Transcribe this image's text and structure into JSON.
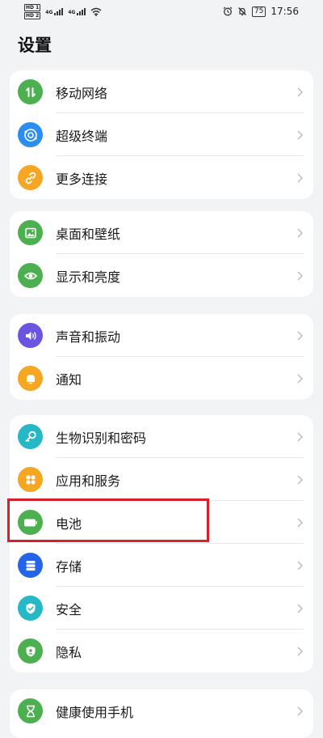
{
  "status_bar": {
    "hd1": "HD 1",
    "hd2": "HD 2",
    "net1": "4G",
    "net2": "4G",
    "battery": "75",
    "time": "17:56"
  },
  "page_title": "设置",
  "colors": {
    "green": "#4caf50",
    "blue": "#2a8ef0",
    "orange": "#f5a623",
    "purple": "#6a55e0",
    "teal": "#27b8c8",
    "navy": "#2464e8",
    "highlight": "#d8202a"
  },
  "groups": [
    {
      "items": [
        {
          "label": "移动网络",
          "icon": "mobile-data-icon"
        },
        {
          "label": "超级终端",
          "icon": "super-device-icon"
        },
        {
          "label": "更多连接",
          "icon": "link-icon"
        }
      ]
    },
    {
      "items": [
        {
          "label": "桌面和壁纸",
          "icon": "wallpaper-icon"
        },
        {
          "label": "显示和亮度",
          "icon": "eye-icon"
        }
      ]
    },
    {
      "items": [
        {
          "label": "声音和振动",
          "icon": "speaker-icon"
        },
        {
          "label": "通知",
          "icon": "bell-icon"
        }
      ]
    },
    {
      "items": [
        {
          "label": "生物识别和密码",
          "icon": "key-icon"
        },
        {
          "label": "应用和服务",
          "icon": "apps-icon"
        },
        {
          "label": "电池",
          "icon": "battery-icon"
        },
        {
          "label": "存储",
          "icon": "storage-icon"
        },
        {
          "label": "安全",
          "icon": "shield-icon"
        },
        {
          "label": "隐私",
          "icon": "privacy-icon"
        }
      ]
    },
    {
      "items": [
        {
          "label": "健康使用手机",
          "icon": "hourglass-icon"
        }
      ]
    }
  ]
}
